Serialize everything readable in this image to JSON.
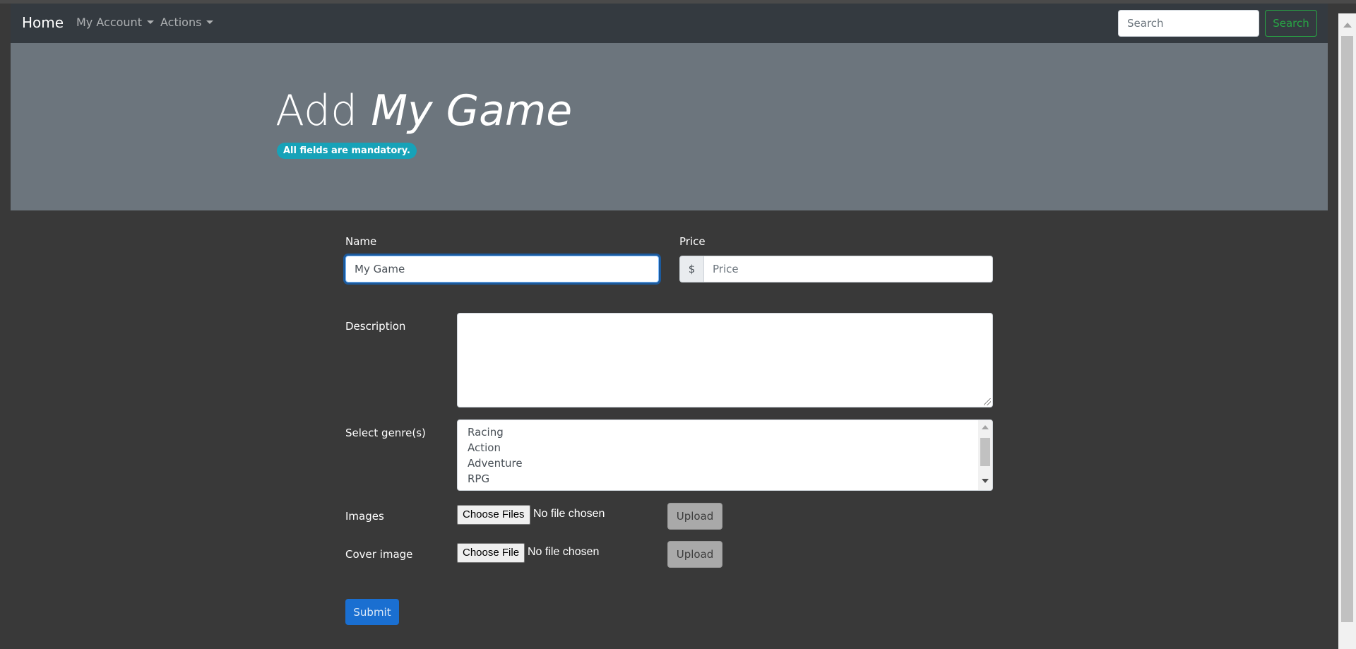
{
  "navbar": {
    "brand": "Home",
    "my_account": "My Account",
    "actions": "Actions",
    "search_placeholder": "Search",
    "search_button": "Search"
  },
  "header": {
    "title_prefix": "Add",
    "title_game": "My Game",
    "badge": "All fields are mandatory."
  },
  "form": {
    "name_label": "Name",
    "name_value": "My Game",
    "price_label": "Price",
    "price_prefix": "$",
    "price_placeholder": "Price",
    "description_label": "Description",
    "genre_label": "Select genre(s)",
    "genres": [
      "Racing",
      "Action",
      "Adventure",
      "RPG"
    ],
    "images_label": "Images",
    "images_choose": "Choose Files",
    "images_status": "No file chosen",
    "cover_label": "Cover image",
    "cover_choose": "Choose File",
    "cover_status": "No file chosen",
    "upload_label": "Upload",
    "submit_label": "Submit"
  },
  "colors": {
    "navbar_bg": "#343a40",
    "jumbotron_bg": "#6c757d",
    "page_bg": "#393939",
    "badge_bg": "#17a2b8",
    "search_outline": "#28a745",
    "submit_bg": "#1a6fd1"
  }
}
